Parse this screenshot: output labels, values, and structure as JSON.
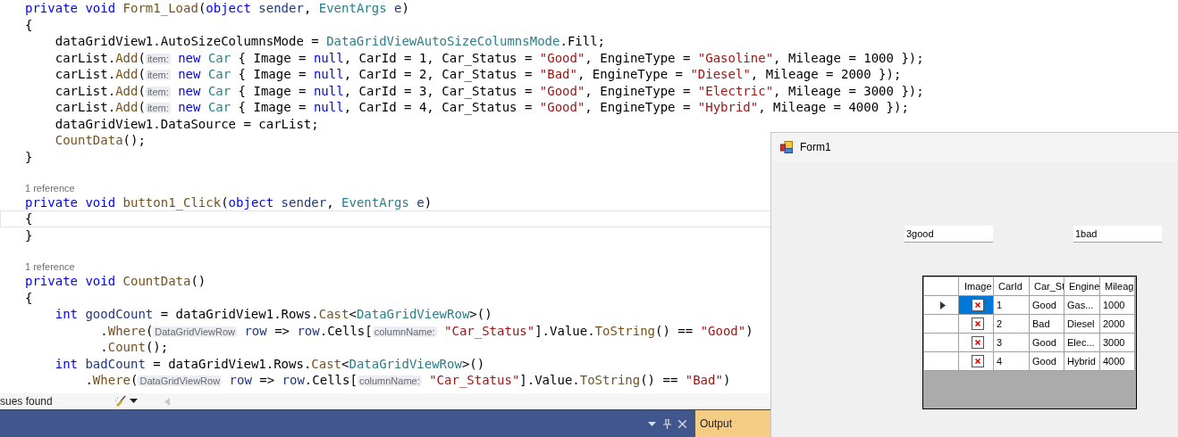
{
  "editor": {
    "lines": [
      {
        "kind": "code",
        "current": false,
        "tokens": [
          {
            "kind": "keyword",
            "text": "private void "
          },
          {
            "kind": "method",
            "text": "Form1_Load"
          },
          {
            "kind": "plain",
            "text": "("
          },
          {
            "kind": "keyword",
            "text": "object "
          },
          {
            "kind": "param",
            "text": "sender"
          },
          {
            "kind": "plain",
            "text": ", "
          },
          {
            "kind": "type",
            "text": "EventArgs "
          },
          {
            "kind": "param",
            "text": "e"
          },
          {
            "kind": "plain",
            "text": ")"
          }
        ]
      },
      {
        "kind": "code",
        "current": false,
        "tokens": [
          {
            "kind": "plain",
            "text": "{"
          }
        ]
      },
      {
        "kind": "code",
        "current": false,
        "tokens": [
          {
            "kind": "plain",
            "text": "    dataGridView1.AutoSizeColumnsMode = "
          },
          {
            "kind": "type",
            "text": "DataGridViewAutoSizeColumnsMode"
          },
          {
            "kind": "plain",
            "text": ".Fill;"
          }
        ]
      },
      {
        "kind": "code",
        "current": false,
        "tokens": [
          {
            "kind": "plain",
            "text": "    carList."
          },
          {
            "kind": "method",
            "text": "Add"
          },
          {
            "kind": "plain",
            "text": "("
          },
          {
            "kind": "hint",
            "text": "item:"
          },
          {
            "kind": "keyword",
            "text": " new "
          },
          {
            "kind": "type",
            "text": "Car"
          },
          {
            "kind": "plain",
            "text": " { Image = "
          },
          {
            "kind": "keyword",
            "text": "null"
          },
          {
            "kind": "plain",
            "text": ", CarId = 1, Car_Status = "
          },
          {
            "kind": "string",
            "text": "\"Good\""
          },
          {
            "kind": "plain",
            "text": ", EngineType = "
          },
          {
            "kind": "string",
            "text": "\"Gasoline\""
          },
          {
            "kind": "plain",
            "text": ", Mileage = 1000 });"
          }
        ]
      },
      {
        "kind": "code",
        "current": false,
        "tokens": [
          {
            "kind": "plain",
            "text": "    carList."
          },
          {
            "kind": "method",
            "text": "Add"
          },
          {
            "kind": "plain",
            "text": "("
          },
          {
            "kind": "hint",
            "text": "item:"
          },
          {
            "kind": "keyword",
            "text": " new "
          },
          {
            "kind": "type",
            "text": "Car"
          },
          {
            "kind": "plain",
            "text": " { Image = "
          },
          {
            "kind": "keyword",
            "text": "null"
          },
          {
            "kind": "plain",
            "text": ", CarId = 2, Car_Status = "
          },
          {
            "kind": "string",
            "text": "\"Bad\""
          },
          {
            "kind": "plain",
            "text": ", EngineType = "
          },
          {
            "kind": "string",
            "text": "\"Diesel\""
          },
          {
            "kind": "plain",
            "text": ", Mileage = 2000 });"
          }
        ]
      },
      {
        "kind": "code",
        "current": false,
        "tokens": [
          {
            "kind": "plain",
            "text": "    carList."
          },
          {
            "kind": "method",
            "text": "Add"
          },
          {
            "kind": "plain",
            "text": "("
          },
          {
            "kind": "hint",
            "text": "item:"
          },
          {
            "kind": "keyword",
            "text": " new "
          },
          {
            "kind": "type",
            "text": "Car"
          },
          {
            "kind": "plain",
            "text": " { Image = "
          },
          {
            "kind": "keyword",
            "text": "null"
          },
          {
            "kind": "plain",
            "text": ", CarId = 3, Car_Status = "
          },
          {
            "kind": "string",
            "text": "\"Good\""
          },
          {
            "kind": "plain",
            "text": ", EngineType = "
          },
          {
            "kind": "string",
            "text": "\"Electric\""
          },
          {
            "kind": "plain",
            "text": ", Mileage = 3000 });"
          }
        ]
      },
      {
        "kind": "code",
        "current": false,
        "tokens": [
          {
            "kind": "plain",
            "text": "    carList."
          },
          {
            "kind": "method",
            "text": "Add"
          },
          {
            "kind": "plain",
            "text": "("
          },
          {
            "kind": "hint",
            "text": "item:"
          },
          {
            "kind": "keyword",
            "text": " new "
          },
          {
            "kind": "type",
            "text": "Car"
          },
          {
            "kind": "plain",
            "text": " { Image = "
          },
          {
            "kind": "keyword",
            "text": "null"
          },
          {
            "kind": "plain",
            "text": ", CarId = 4, Car_Status = "
          },
          {
            "kind": "string",
            "text": "\"Good\""
          },
          {
            "kind": "plain",
            "text": ", EngineType = "
          },
          {
            "kind": "string",
            "text": "\"Hybrid\""
          },
          {
            "kind": "plain",
            "text": ", Mileage = 4000 });"
          }
        ]
      },
      {
        "kind": "code",
        "current": false,
        "tokens": [
          {
            "kind": "plain",
            "text": "    dataGridView1.DataSource = carList;"
          }
        ]
      },
      {
        "kind": "code",
        "current": false,
        "tokens": [
          {
            "kind": "method",
            "text": "    CountData"
          },
          {
            "kind": "plain",
            "text": "();"
          }
        ]
      },
      {
        "kind": "code",
        "current": false,
        "tokens": [
          {
            "kind": "plain",
            "text": "}"
          }
        ]
      },
      {
        "kind": "blank"
      },
      {
        "kind": "codelens",
        "text": "1 reference"
      },
      {
        "kind": "code",
        "current": false,
        "tokens": [
          {
            "kind": "keyword",
            "text": "private void "
          },
          {
            "kind": "method",
            "text": "button1_Click"
          },
          {
            "kind": "plain",
            "text": "("
          },
          {
            "kind": "keyword",
            "text": "object "
          },
          {
            "kind": "param",
            "text": "sender"
          },
          {
            "kind": "plain",
            "text": ", "
          },
          {
            "kind": "type",
            "text": "EventArgs "
          },
          {
            "kind": "param",
            "text": "e"
          },
          {
            "kind": "plain",
            "text": ")"
          }
        ]
      },
      {
        "kind": "code",
        "current": true,
        "tokens": [
          {
            "kind": "plain",
            "text": "{"
          }
        ]
      },
      {
        "kind": "code",
        "current": false,
        "tokens": [
          {
            "kind": "plain",
            "text": "}"
          }
        ]
      },
      {
        "kind": "blank"
      },
      {
        "kind": "codelens",
        "text": "1 reference"
      },
      {
        "kind": "code",
        "current": false,
        "tokens": [
          {
            "kind": "keyword",
            "text": "private void "
          },
          {
            "kind": "method",
            "text": "CountData"
          },
          {
            "kind": "plain",
            "text": "()"
          }
        ]
      },
      {
        "kind": "code",
        "current": false,
        "tokens": [
          {
            "kind": "plain",
            "text": "{"
          }
        ]
      },
      {
        "kind": "code",
        "current": false,
        "tokens": [
          {
            "kind": "keyword",
            "text": "    int "
          },
          {
            "kind": "param",
            "text": "goodCount"
          },
          {
            "kind": "plain",
            "text": " = dataGridView1.Rows."
          },
          {
            "kind": "method",
            "text": "Cast"
          },
          {
            "kind": "plain",
            "text": "<"
          },
          {
            "kind": "type",
            "text": "DataGridViewRow"
          },
          {
            "kind": "plain",
            "text": ">()"
          }
        ]
      },
      {
        "kind": "code",
        "current": false,
        "tokens": [
          {
            "kind": "plain",
            "text": "          ."
          },
          {
            "kind": "method",
            "text": "Where"
          },
          {
            "kind": "plain",
            "text": "("
          },
          {
            "kind": "hint",
            "text": "DataGridViewRow"
          },
          {
            "kind": "param",
            "text": " row"
          },
          {
            "kind": "plain",
            "text": " => "
          },
          {
            "kind": "param",
            "text": "row"
          },
          {
            "kind": "plain",
            "text": ".Cells["
          },
          {
            "kind": "hint",
            "text": "columnName:"
          },
          {
            "kind": "string",
            "text": " \"Car_Status\""
          },
          {
            "kind": "plain",
            "text": "].Value."
          },
          {
            "kind": "method",
            "text": "ToString"
          },
          {
            "kind": "plain",
            "text": "() == "
          },
          {
            "kind": "string",
            "text": "\"Good\""
          },
          {
            "kind": "plain",
            "text": ")"
          }
        ]
      },
      {
        "kind": "code",
        "current": false,
        "tokens": [
          {
            "kind": "plain",
            "text": "          ."
          },
          {
            "kind": "method",
            "text": "Count"
          },
          {
            "kind": "plain",
            "text": "();"
          }
        ]
      },
      {
        "kind": "code",
        "current": false,
        "tokens": [
          {
            "kind": "keyword",
            "text": "    int "
          },
          {
            "kind": "param",
            "text": "badCount"
          },
          {
            "kind": "plain",
            "text": " = dataGridView1.Rows."
          },
          {
            "kind": "method",
            "text": "Cast"
          },
          {
            "kind": "plain",
            "text": "<"
          },
          {
            "kind": "type",
            "text": "DataGridViewRow"
          },
          {
            "kind": "plain",
            "text": ">()"
          }
        ]
      },
      {
        "kind": "code",
        "current": false,
        "tokens": [
          {
            "kind": "plain",
            "text": "        ."
          },
          {
            "kind": "method",
            "text": "Where"
          },
          {
            "kind": "plain",
            "text": "("
          },
          {
            "kind": "hint",
            "text": "DataGridViewRow"
          },
          {
            "kind": "param",
            "text": " row"
          },
          {
            "kind": "plain",
            "text": " => "
          },
          {
            "kind": "param",
            "text": "row"
          },
          {
            "kind": "plain",
            "text": ".Cells["
          },
          {
            "kind": "hint",
            "text": "columnName:"
          },
          {
            "kind": "string",
            "text": " \"Car_Status\""
          },
          {
            "kind": "plain",
            "text": "].Value."
          },
          {
            "kind": "method",
            "text": "ToString"
          },
          {
            "kind": "plain",
            "text": "() == "
          },
          {
            "kind": "string",
            "text": "\"Bad\""
          },
          {
            "kind": "plain",
            "text": ")"
          }
        ]
      }
    ]
  },
  "status_bar": {
    "issues": "sues found"
  },
  "bottom_panel": {
    "tab": "Output"
  },
  "form_window": {
    "title": "Form1",
    "textboxes": [
      {
        "value": "3good"
      },
      {
        "value": "1bad"
      }
    ],
    "grid": {
      "image_column": "Image",
      "columns": [
        "CarId",
        "Car_St",
        "Engine",
        "Mileag"
      ],
      "rows": [
        {
          "selected": true,
          "cells": [
            "1",
            "Good",
            "Gas...",
            "1000"
          ]
        },
        {
          "selected": false,
          "cells": [
            "2",
            "Bad",
            "Diesel",
            "2000"
          ]
        },
        {
          "selected": false,
          "cells": [
            "3",
            "Good",
            "Elec...",
            "3000"
          ]
        },
        {
          "selected": false,
          "cells": [
            "4",
            "Good",
            "Hybrid",
            "4000"
          ]
        }
      ]
    }
  }
}
